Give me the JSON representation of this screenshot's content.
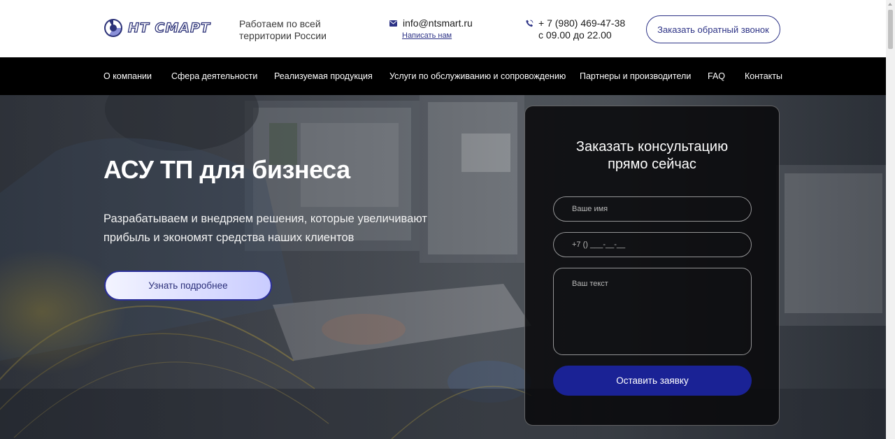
{
  "header": {
    "logo_text": "НТ СМАРТ",
    "region_line1": "Работаем по всей",
    "region_line2": "территории России",
    "email": "info@ntsmart.ru",
    "write_us": "Написать нам",
    "phone": "+ 7 (980) 469-47-38",
    "hours": "с 09.00 до 22.00",
    "callback_button": "Заказать обратный звонок"
  },
  "nav": {
    "items": [
      "О компании",
      "Сфера деятельности",
      "Реализуемая продукция",
      "Услуги по обслуживанию и сопровождению",
      "Партнеры и производители",
      "FAQ",
      "Контакты"
    ]
  },
  "hero": {
    "title": "АСУ ТП для бизнеса",
    "subtitle_line1": "Разрабатываем и внедряем решения, которые увеличивают",
    "subtitle_line2": "прибыль и экономят средства наших клиентов",
    "more_button": "Узнать подробнее"
  },
  "form": {
    "title_line1": "Заказать консультацию",
    "title_line2": "прямо сейчас",
    "name_placeholder": "Ваше имя",
    "phone_placeholder": "+7 () ___-__-__",
    "text_placeholder": "Ваш текст",
    "submit_button": "Оставить заявку"
  },
  "colors": {
    "brand": "#2d3386",
    "nav_bg": "#000000",
    "submit_bg": "#1a2295",
    "form_bg": "#0a0a0c"
  },
  "icons": [
    "logo-mark-icon",
    "mail-icon",
    "phone-icon",
    "scroll-up-arrow-icon"
  ]
}
